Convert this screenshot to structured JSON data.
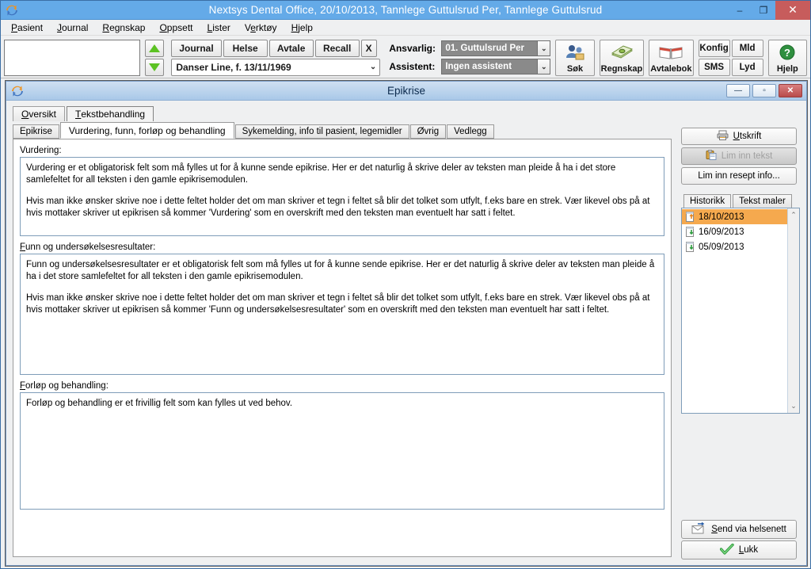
{
  "window": {
    "title": "Nextsys Dental Office,  20/10/2013, Tannlege Guttulsrud Per,  Tannlege Guttulsrud",
    "app_icon": "refresh-arrows-icon",
    "minimize": "–",
    "restore": "❐",
    "close": "✕"
  },
  "menubar": {
    "items": [
      {
        "label": "Pasient",
        "accel": "P"
      },
      {
        "label": "Journal",
        "accel": "J"
      },
      {
        "label": "Regnskap",
        "accel": "R"
      },
      {
        "label": "Oppsett",
        "accel": "O"
      },
      {
        "label": "Lister",
        "accel": "L"
      },
      {
        "label": "Verktøy",
        "accel": "V"
      },
      {
        "label": "Hjelp",
        "accel": "H"
      }
    ]
  },
  "toolbar": {
    "patient_search_value": "",
    "patient_search_placeholder": "",
    "arrow_up": "nav-up-icon",
    "arrow_down": "nav-down-icon",
    "nav_buttons": [
      "Journal",
      "Helse",
      "Avtale",
      "Recall"
    ],
    "close_patient": "X",
    "patient_combo_value": "Danser Line, f. 13/11/1969",
    "chevron": "⌄",
    "ansvarlig_label": "Ansvarlig:",
    "ansvarlig_value": "01. Guttulsrud Per",
    "assistent_label": "Assistent:",
    "assistent_value": "Ingen assistent",
    "icon_buttons": [
      {
        "label": "Søk",
        "icon": "people-search-icon",
        "glyph": "👥"
      },
      {
        "label": "Regnskap",
        "icon": "money-icon",
        "glyph": "💵"
      },
      {
        "label": "Avtalebok",
        "icon": "open-book-icon",
        "glyph": "📖"
      }
    ],
    "small_buttons": [
      "Konfig",
      "Mld",
      "SMS",
      "Lyd"
    ],
    "help_button": {
      "label": "Hjelp",
      "icon": "help-question-icon",
      "glyph": "?"
    }
  },
  "dialog": {
    "title": "Epikrise",
    "icon": "refresh-arrows-icon",
    "minimize": "—",
    "restore": "▫",
    "close": "✕",
    "mode_tabs": [
      {
        "label": "Oversikt",
        "accel": "O",
        "active": false
      },
      {
        "label": "Tekstbehandling",
        "accel": "T",
        "active": true
      }
    ],
    "sub_tabs": [
      {
        "label": "Epikrise",
        "active": false
      },
      {
        "label": "Vurdering, funn, forløp og behandling",
        "active": true
      },
      {
        "label": "Sykemelding, info til pasient, legemidler",
        "active": false
      },
      {
        "label": "Øvrig",
        "active": false
      },
      {
        "label": "Vedlegg",
        "active": false
      }
    ],
    "fields": [
      {
        "name": "vurdering",
        "label": "Vurdering:",
        "accel": "",
        "paragraphs": [
          "Vurdering er et obligatorisk felt som må fylles ut for å kunne sende epikrise. Her er det naturlig å skrive deler av teksten man pleide å ha i det store samlefeltet for all teksten i den gamle epikrisemodulen.",
          "Hvis man ikke ønsker skrive noe i dette feltet holder det om man skriver et tegn i feltet så blir det tolket som utfylt, f.eks bare en strek. Vær likevel obs på at hvis mottaker skriver ut epikrisen så kommer 'Vurdering' som en overskrift med den teksten man eventuelt har satt i feltet."
        ]
      },
      {
        "name": "funn",
        "label": "Funn og undersøkelsesresultater:",
        "accel": "F",
        "paragraphs": [
          "Funn og undersøkelsesresultater er et obligatorisk felt som må fylles ut for å kunne sende epikrise. Her er det naturlig å skrive deler av teksten man pleide å ha i det store samlefeltet for all teksten i den gamle epikrisemodulen.",
          "Hvis man ikke ønsker skrive noe i dette feltet holder det om man skriver et tegn i feltet så blir det tolket som utfylt, f.eks bare en strek. Vær likevel obs på at hvis mottaker skriver ut epikrisen så kommer 'Funn og undersøkelsesresultater' som en overskrift med den teksten man eventuelt har satt i feltet."
        ]
      },
      {
        "name": "forlop",
        "label": "Forløp og behandling:",
        "accel": "F",
        "paragraphs": [
          "Forløp og behandling er et frivillig felt som kan fylles ut ved behov."
        ]
      }
    ],
    "actions": [
      {
        "name": "utskrift",
        "label": "Utskrift",
        "accel": "U",
        "icon": "printer-icon",
        "glyph": "🖨",
        "disabled": false
      },
      {
        "name": "lim-inn-tekst",
        "label": "Lim inn tekst",
        "accel": "",
        "icon": "clipboard-paste-icon",
        "glyph": "📋",
        "disabled": true
      },
      {
        "name": "lim-inn-resept",
        "label": "Lim inn resept info...",
        "accel": "",
        "icon": "",
        "glyph": "",
        "disabled": false
      }
    ],
    "history": {
      "tabs": [
        {
          "label": "Historikk",
          "active": true
        },
        {
          "label": "Tekst maler",
          "active": false
        }
      ],
      "items": [
        {
          "date": "18/10/2013",
          "icon": "document-up-icon",
          "selected": true
        },
        {
          "date": "16/09/2013",
          "icon": "document-down-icon",
          "selected": false
        },
        {
          "date": "05/09/2013",
          "icon": "document-down-icon",
          "selected": false
        }
      ],
      "scroll_up": "⌃",
      "scroll_down": "⌄"
    },
    "bottom_buttons": [
      {
        "name": "send-via-helsenett",
        "label": "Send via helsenett",
        "accel": "S",
        "icon": "envelope-send-icon"
      },
      {
        "name": "lukk",
        "label": "Lukk",
        "accel": "L",
        "icon": "green-check-icon"
      }
    ]
  }
}
